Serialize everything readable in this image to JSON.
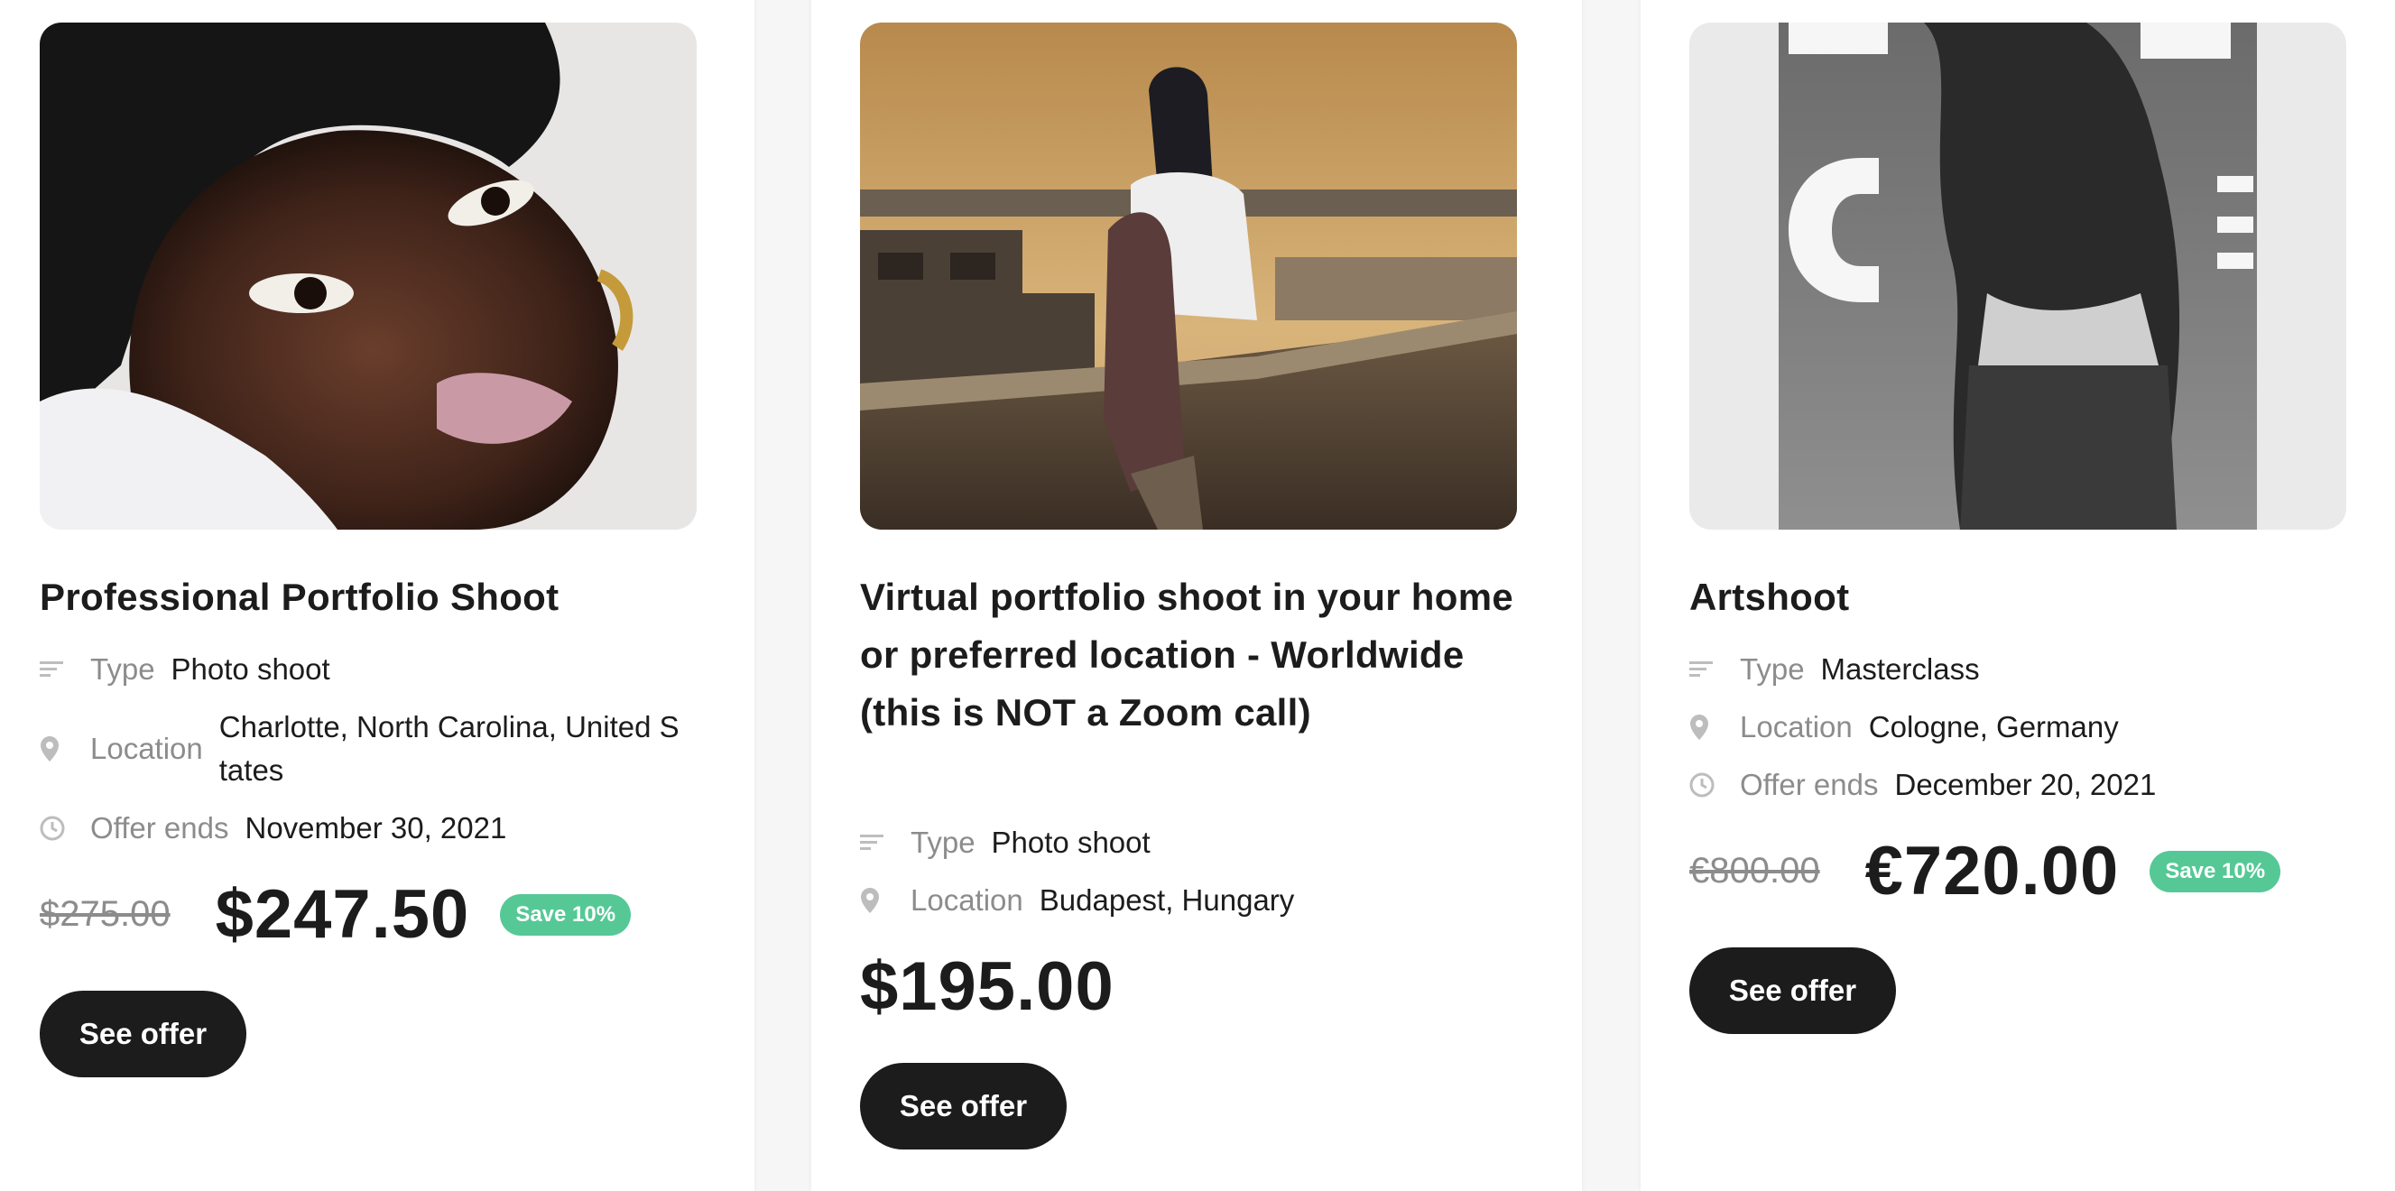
{
  "offers": [
    {
      "title": "Professional Portfolio Shoot",
      "photo_icon": "portrait-photo",
      "type_label": "Type",
      "type_value": "Photo shoot",
      "location_label": "Location",
      "location_value": "Charlotte, North Carolina, United States",
      "ends_label": "Offer ends",
      "ends_value": "November 30, 2021",
      "old_price": "$275.00",
      "price": "$247.50",
      "badge": "Save 10%",
      "button": "See offer"
    },
    {
      "title": "Virtual portfolio shoot in your home or preferred location - Worldwide (this is NOT a Zoom call)",
      "photo_icon": "rooftop-photo",
      "type_label": "Type",
      "type_value": "Photo shoot",
      "location_label": "Location",
      "location_value": "Budapest, Hungary",
      "price": "$195.00",
      "button": "See offer"
    },
    {
      "title": "Artshoot",
      "photo_icon": "artshoot-photo",
      "type_label": "Type",
      "type_value": "Masterclass",
      "location_label": "Location",
      "location_value": "Cologne, Germany",
      "ends_label": "Offer ends",
      "ends_value": "December 20, 2021",
      "old_price": "€800.00",
      "price": "€720.00",
      "badge": "Save 10%",
      "button": "See offer"
    }
  ],
  "colors": {
    "badge": "#55c896",
    "button": "#1c1c1c",
    "muted": "#8c8c8c"
  }
}
